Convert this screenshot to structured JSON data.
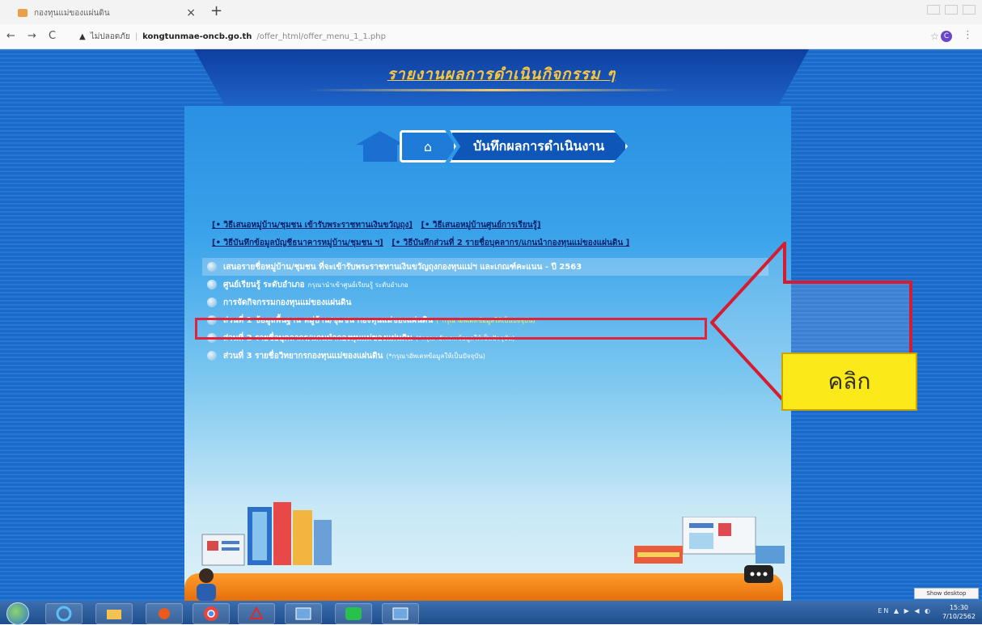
{
  "browser": {
    "tab_title": "กองทุนแม่ของแผ่นดิน",
    "tab_close": "×",
    "new_tab": "+",
    "nav_back": "←",
    "nav_forward": "→",
    "nav_reload": "C",
    "security_label": "ไม่ปลอดภัย",
    "url_host": "kongtunmae-oncb.go.th",
    "url_path": "/offer_html/offer_menu_1_1.php",
    "profile_initial": "C",
    "star": "☆",
    "menu_dots": "⋮"
  },
  "page": {
    "banner_title": "รายงานผลการดำเนินกิจกรรม ๆ",
    "home_arrow_icon": "⌂",
    "section_title": "บันทึกผลการดำเนินงาน",
    "links_row1": [
      "[• วิธีเสนอหมู่บ้าน/ชุมชน เข้ารับพระราชทานเงินขวัญถุง]",
      "[• วิธีเสนอหมู่บ้านศูนย์การเรียนรู้]"
    ],
    "links_row2": [
      "[• วิธีบันทึกข้อมูลบัญชีธนาคารหมู่บ้าน/ชุมชน ฯ]",
      "[• วิธีบันทึกส่วนที่ 2 รายชื่อบุคลากร/แกนนำกองทุนแม่ของแผ่นดิน ]"
    ],
    "menu_items": [
      {
        "label": "เสนอรายชื่อหมู่บ้าน/ชุมชน ที่จะเข้ารับพระราชทานเงินขวัญถุงกองทุนแม่ฯ และเกณฑ์คะแนน - ปี 2563",
        "sub": ""
      },
      {
        "label": "ศูนย์เรียนรู้ ระดับอำเภอ",
        "sub": "กรุณานำเข้าศูนย์เรียนรู้ ระดับอำเภอ"
      },
      {
        "label": "การจัดกิจกรรมกองทุนแม่ของแผ่นดิน",
        "sub": ""
      },
      {
        "label": "ส่วนที่ 1 ข้อมูลพื้นฐาน หมู่บ้าน/ชุมชน กองทุนแม่ของแผ่นดิน",
        "sub": "(*กรุณาอัพเดทข้อมูลให้เป็นปัจจุบัน)"
      },
      {
        "label": "ส่วนที่ 2 รายชื่อบุคลากร/แกนนำกองทุนแม่ของแผ่นดิน",
        "sub": "(*กรุณาอัพเดทข้อมูลให้เป็นปัจจุบัน)"
      },
      {
        "label": "ส่วนที่ 3 รายชื่อวิทยากรกองทุนแม่ของแผ่นดิน",
        "sub": "(*กรุณาอัพเดทข้อมูลให้เป็นปัจจุบัน)"
      }
    ],
    "callout_label": "คลิก"
  },
  "taskbar": {
    "show_desktop": "Show desktop",
    "tray": "EN ▲ ▶ ◀ ◐",
    "clock_time": "15:30",
    "clock_date": "7/10/2562"
  },
  "colors": {
    "page_bg": "#1b6fd1",
    "highlight_border": "#e0223a",
    "callout_bg": "#fbe91a"
  }
}
